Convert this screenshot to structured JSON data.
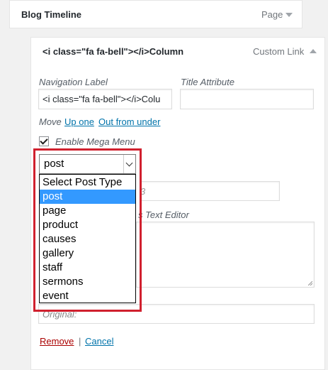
{
  "parent_item": {
    "title": "Blog Timeline",
    "type": "Page"
  },
  "item": {
    "title": "<i class=\"fa fa-bell\"></i>Column",
    "type": "Custom Link",
    "navigation_label": "Navigation Label",
    "navigation_value": "<i class=\"fa fa-bell\"></i>Colu",
    "title_attribute": "Title Attribute",
    "title_attribute_value": "",
    "move_label": "Move",
    "move_up": "Up one",
    "move_out": "Out from under",
    "mega_menu_label": "Enable Mega Menu",
    "mega_menu_checked": true,
    "hidden_field_suffix": "3",
    "editor_label_suffix": "s Text Editor",
    "original_label": "Original:",
    "remove": "Remove",
    "separator": "|",
    "cancel": "Cancel"
  },
  "post_type_select": {
    "selected": "post",
    "options": [
      "Select Post Type",
      "post",
      "page",
      "product",
      "causes",
      "gallery",
      "staff",
      "sermons",
      "event"
    ],
    "highlighted_index": 1,
    "highlight_color": "#d0202e"
  }
}
